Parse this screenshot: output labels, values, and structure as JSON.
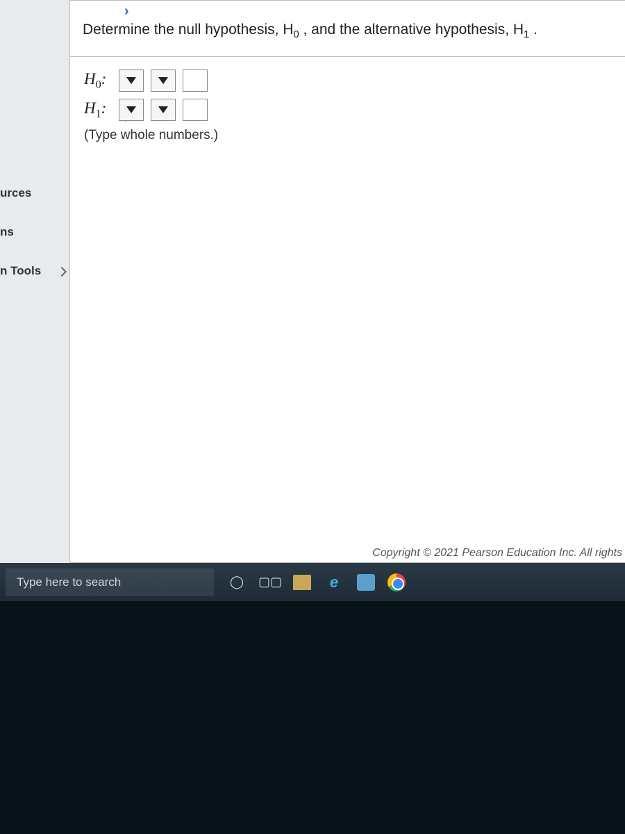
{
  "sidebar": {
    "items": [
      {
        "label": "urces"
      },
      {
        "label": "ns"
      },
      {
        "label": "n Tools"
      }
    ]
  },
  "question": {
    "prompt_prefix": "Determine the null hypothesis, ",
    "h0_symbol": "H",
    "h0_sub": "0",
    "prompt_mid": ", and the alternative hypothesis, ",
    "h1_symbol": "H",
    "h1_sub": "1",
    "prompt_suffix": "."
  },
  "answers": {
    "rows": [
      {
        "label_main": "H",
        "label_sub": "0",
        "label_colon": ":"
      },
      {
        "label_main": "H",
        "label_sub": "1",
        "label_colon": ":"
      }
    ],
    "hint": "(Type whole numbers.)"
  },
  "copyright": "Copyright © 2021 Pearson Education Inc. All rights",
  "taskbar": {
    "search_placeholder": "Type here to search"
  }
}
